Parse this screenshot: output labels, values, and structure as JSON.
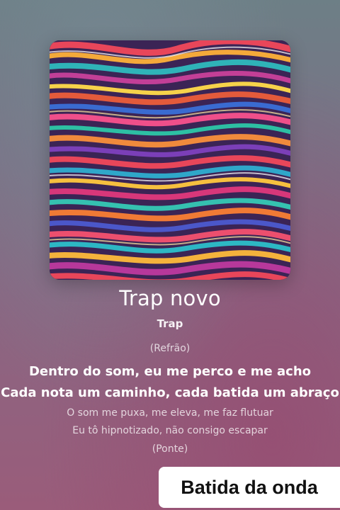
{
  "song": {
    "title": "Trap novo",
    "genre": "Trap"
  },
  "lyrics": {
    "lines": [
      "(Refrão)",
      "Dentro do som, eu me perco e me acho",
      "Cada nota um caminho, cada batida um abraço",
      "O som me puxa, me eleva, me faz flutuar",
      "Eu tô hipnotizado, não consigo escapar",
      "(Ponte)"
    ]
  },
  "overlay": {
    "label": "Batida da onda"
  },
  "colors": {
    "active_lyric": "#ffffff",
    "dim_lyric": "rgba(255,255,255,0.75)",
    "overlay_bg": "#ffffff"
  }
}
